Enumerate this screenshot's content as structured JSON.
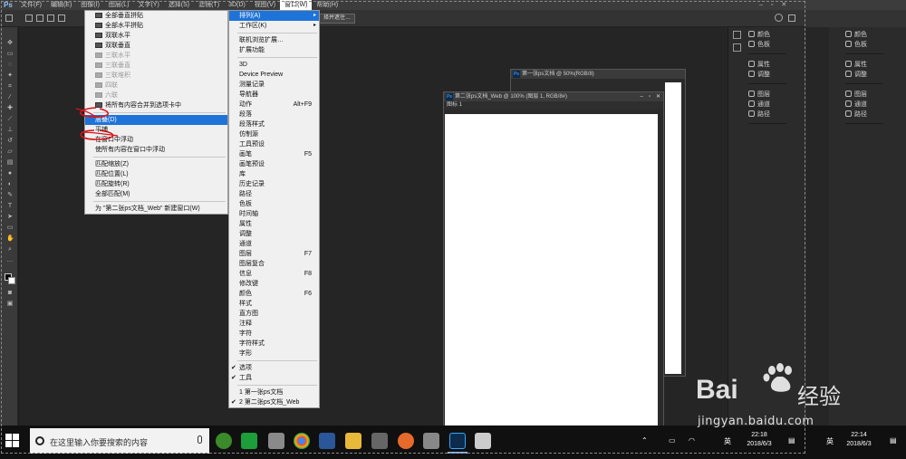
{
  "app": {
    "logo": "Ps",
    "menus": [
      "文件(F)",
      "编辑(E)",
      "图像(I)",
      "图层(L)",
      "文字(Y)",
      "选择(S)",
      "滤镜(T)",
      "3D(D)",
      "视图(V)",
      "窗口(W)",
      "帮助(H)"
    ],
    "active_menu_index": 9,
    "win_controls": [
      "–",
      "▫",
      "✕"
    ]
  },
  "options_bar": {
    "button_label": "择并遮住…"
  },
  "arrange_menu": {
    "items": [
      {
        "label": "全部垂直拼贴",
        "state": "normal"
      },
      {
        "label": "全部水平拼贴",
        "state": "normal"
      },
      {
        "label": "双联水平",
        "state": "normal"
      },
      {
        "label": "双联垂直",
        "state": "normal"
      },
      {
        "label": "三联水平",
        "state": "disabled"
      },
      {
        "label": "三联垂直",
        "state": "disabled"
      },
      {
        "label": "三联堆积",
        "state": "disabled"
      },
      {
        "label": "四联",
        "state": "disabled"
      },
      {
        "label": "六联",
        "state": "disabled"
      },
      {
        "label": "将所有内容合并到选项卡中",
        "state": "normal"
      }
    ],
    "float_items": [
      {
        "label": "层叠(D)",
        "state": "highlight"
      },
      {
        "label": "平铺",
        "state": "normal"
      },
      {
        "label": "在窗口中浮动",
        "state": "normal"
      },
      {
        "label": "使所有内容在窗口中浮动",
        "state": "normal"
      }
    ],
    "match_items": [
      "匹配缩放(Z)",
      "匹配位置(L)",
      "匹配旋转(R)",
      "全部匹配(M)"
    ],
    "new_window_item": "为 \"第二张ps文档_Web\" 新建窗口(W)"
  },
  "window_menu": {
    "top": [
      {
        "label": "排列(A)",
        "arrow": "▸",
        "highlight": true
      },
      {
        "label": "工作区(K)",
        "arrow": "▸",
        "highlight": false
      }
    ],
    "ext": [
      "联机浏览扩展…",
      "扩展功能"
    ],
    "panels": [
      {
        "label": "3D",
        "sc": ""
      },
      {
        "label": "Device Preview",
        "sc": ""
      },
      {
        "label": "测量记录",
        "sc": ""
      },
      {
        "label": "导航器",
        "sc": ""
      },
      {
        "label": "动作",
        "sc": "Alt+F9"
      },
      {
        "label": "段落",
        "sc": ""
      },
      {
        "label": "段落样式",
        "sc": ""
      },
      {
        "label": "仿制源",
        "sc": ""
      },
      {
        "label": "工具预设",
        "sc": ""
      },
      {
        "label": "画笔",
        "sc": "F5"
      },
      {
        "label": "画笔预设",
        "sc": ""
      },
      {
        "label": "库",
        "sc": ""
      },
      {
        "label": "历史记录",
        "sc": ""
      },
      {
        "label": "路径",
        "sc": ""
      },
      {
        "label": "色板",
        "sc": ""
      },
      {
        "label": "时间轴",
        "sc": ""
      },
      {
        "label": "属性",
        "sc": ""
      },
      {
        "label": "调整",
        "sc": ""
      },
      {
        "label": "通道",
        "sc": ""
      },
      {
        "label": "图层",
        "sc": "F7"
      },
      {
        "label": "图层复合",
        "sc": ""
      },
      {
        "label": "信息",
        "sc": "F8"
      },
      {
        "label": "修改键",
        "sc": ""
      },
      {
        "label": "颜色",
        "sc": "F6"
      },
      {
        "label": "样式",
        "sc": ""
      },
      {
        "label": "直方图",
        "sc": ""
      },
      {
        "label": "注释",
        "sc": ""
      },
      {
        "label": "字符",
        "sc": ""
      },
      {
        "label": "字符样式",
        "sc": ""
      },
      {
        "label": "字形",
        "sc": ""
      }
    ],
    "toggles": [
      {
        "label": "选项",
        "check": "✔"
      },
      {
        "label": "工具",
        "check": "✔"
      }
    ],
    "docs": [
      {
        "label": "1 第一张ps文档",
        "check": ""
      },
      {
        "label": "2 第二张ps文档_Web",
        "check": "✔"
      }
    ]
  },
  "panels": {
    "group1": [
      "颜色",
      "色板"
    ],
    "group2": [
      "属性",
      "调整"
    ],
    "group3": [
      "图层",
      "通道",
      "路径"
    ]
  },
  "doc_back": {
    "title": "第一张ps文档 @ 50%(RGB/8)"
  },
  "doc_front": {
    "title": "第二张ps文档_Web @ 100% (图层 1, RGB/8#)",
    "layer_label": "图标 1"
  },
  "taskbar": {
    "search_placeholder": "在这里输入你要搜索的内容",
    "clock1_time": "22:18",
    "clock1_date": "2018/6/3",
    "clock2_time": "22:14",
    "clock2_date": "2018/6/3",
    "ime_label": "英"
  },
  "watermark": {
    "brand": "Bai",
    "brand2": "经验",
    "url": "jingyan.baidu.com"
  },
  "colors": {
    "menu_highlight": "#1e73d9",
    "annotation": "#d8141b"
  }
}
